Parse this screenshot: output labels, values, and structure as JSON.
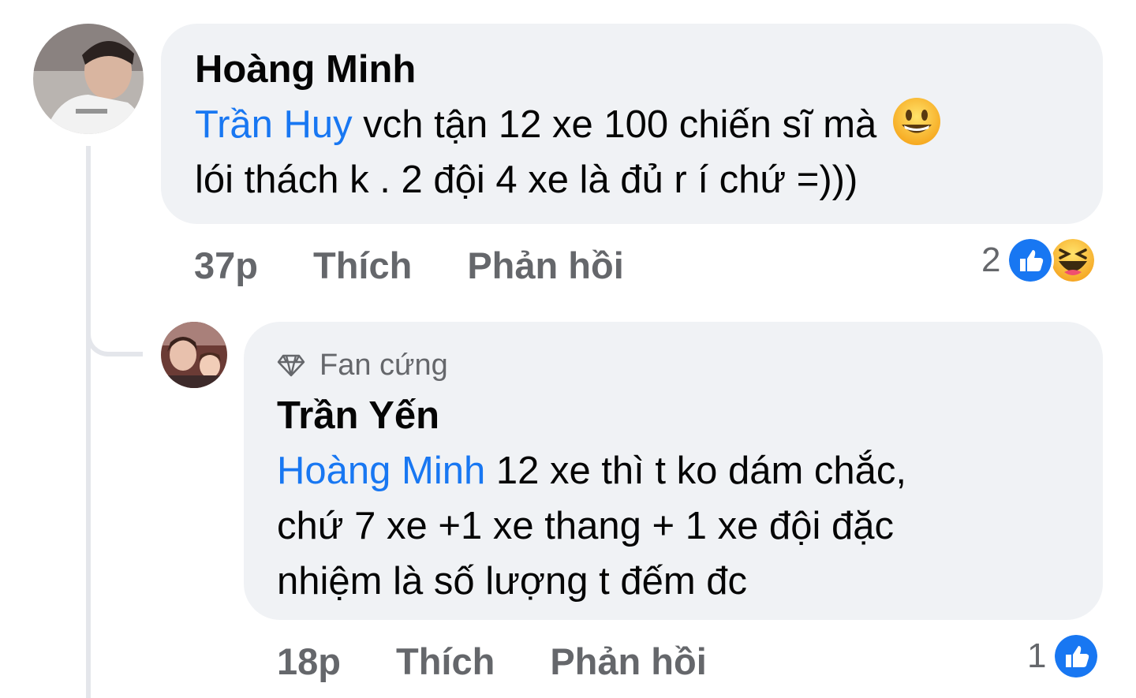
{
  "comments": [
    {
      "author": "Hoàng Minh",
      "mention": "Trần Huy",
      "text_line1": " vch tận 12 xe 100 chiến sĩ mà ",
      "text_line2": "lói thách k . 2 đội 4 xe là đủ r í chứ =)))",
      "time": "37p",
      "like_label": "Thích",
      "reply_label": "Phản hồi",
      "reaction_count": "2",
      "reactions": [
        "like-icon",
        "haha-icon"
      ]
    },
    {
      "badge": "Fan cứng",
      "author": "Trần Yến",
      "mention": "Hoàng Minh",
      "text_line1": " 12 xe thì t ko dám chắc,",
      "text_line2": "chứ 7 xe +1 xe thang + 1 xe đội đặc",
      "text_line3": "nhiệm là số lượng t đếm đc",
      "time": "18p",
      "like_label": "Thích",
      "reply_label": "Phản hồi",
      "reaction_count": "1",
      "reactions": [
        "like-icon"
      ]
    }
  ],
  "colors": {
    "mention": "#1877f2",
    "bubble": "#f0f2f5",
    "meta": "#65676b"
  }
}
